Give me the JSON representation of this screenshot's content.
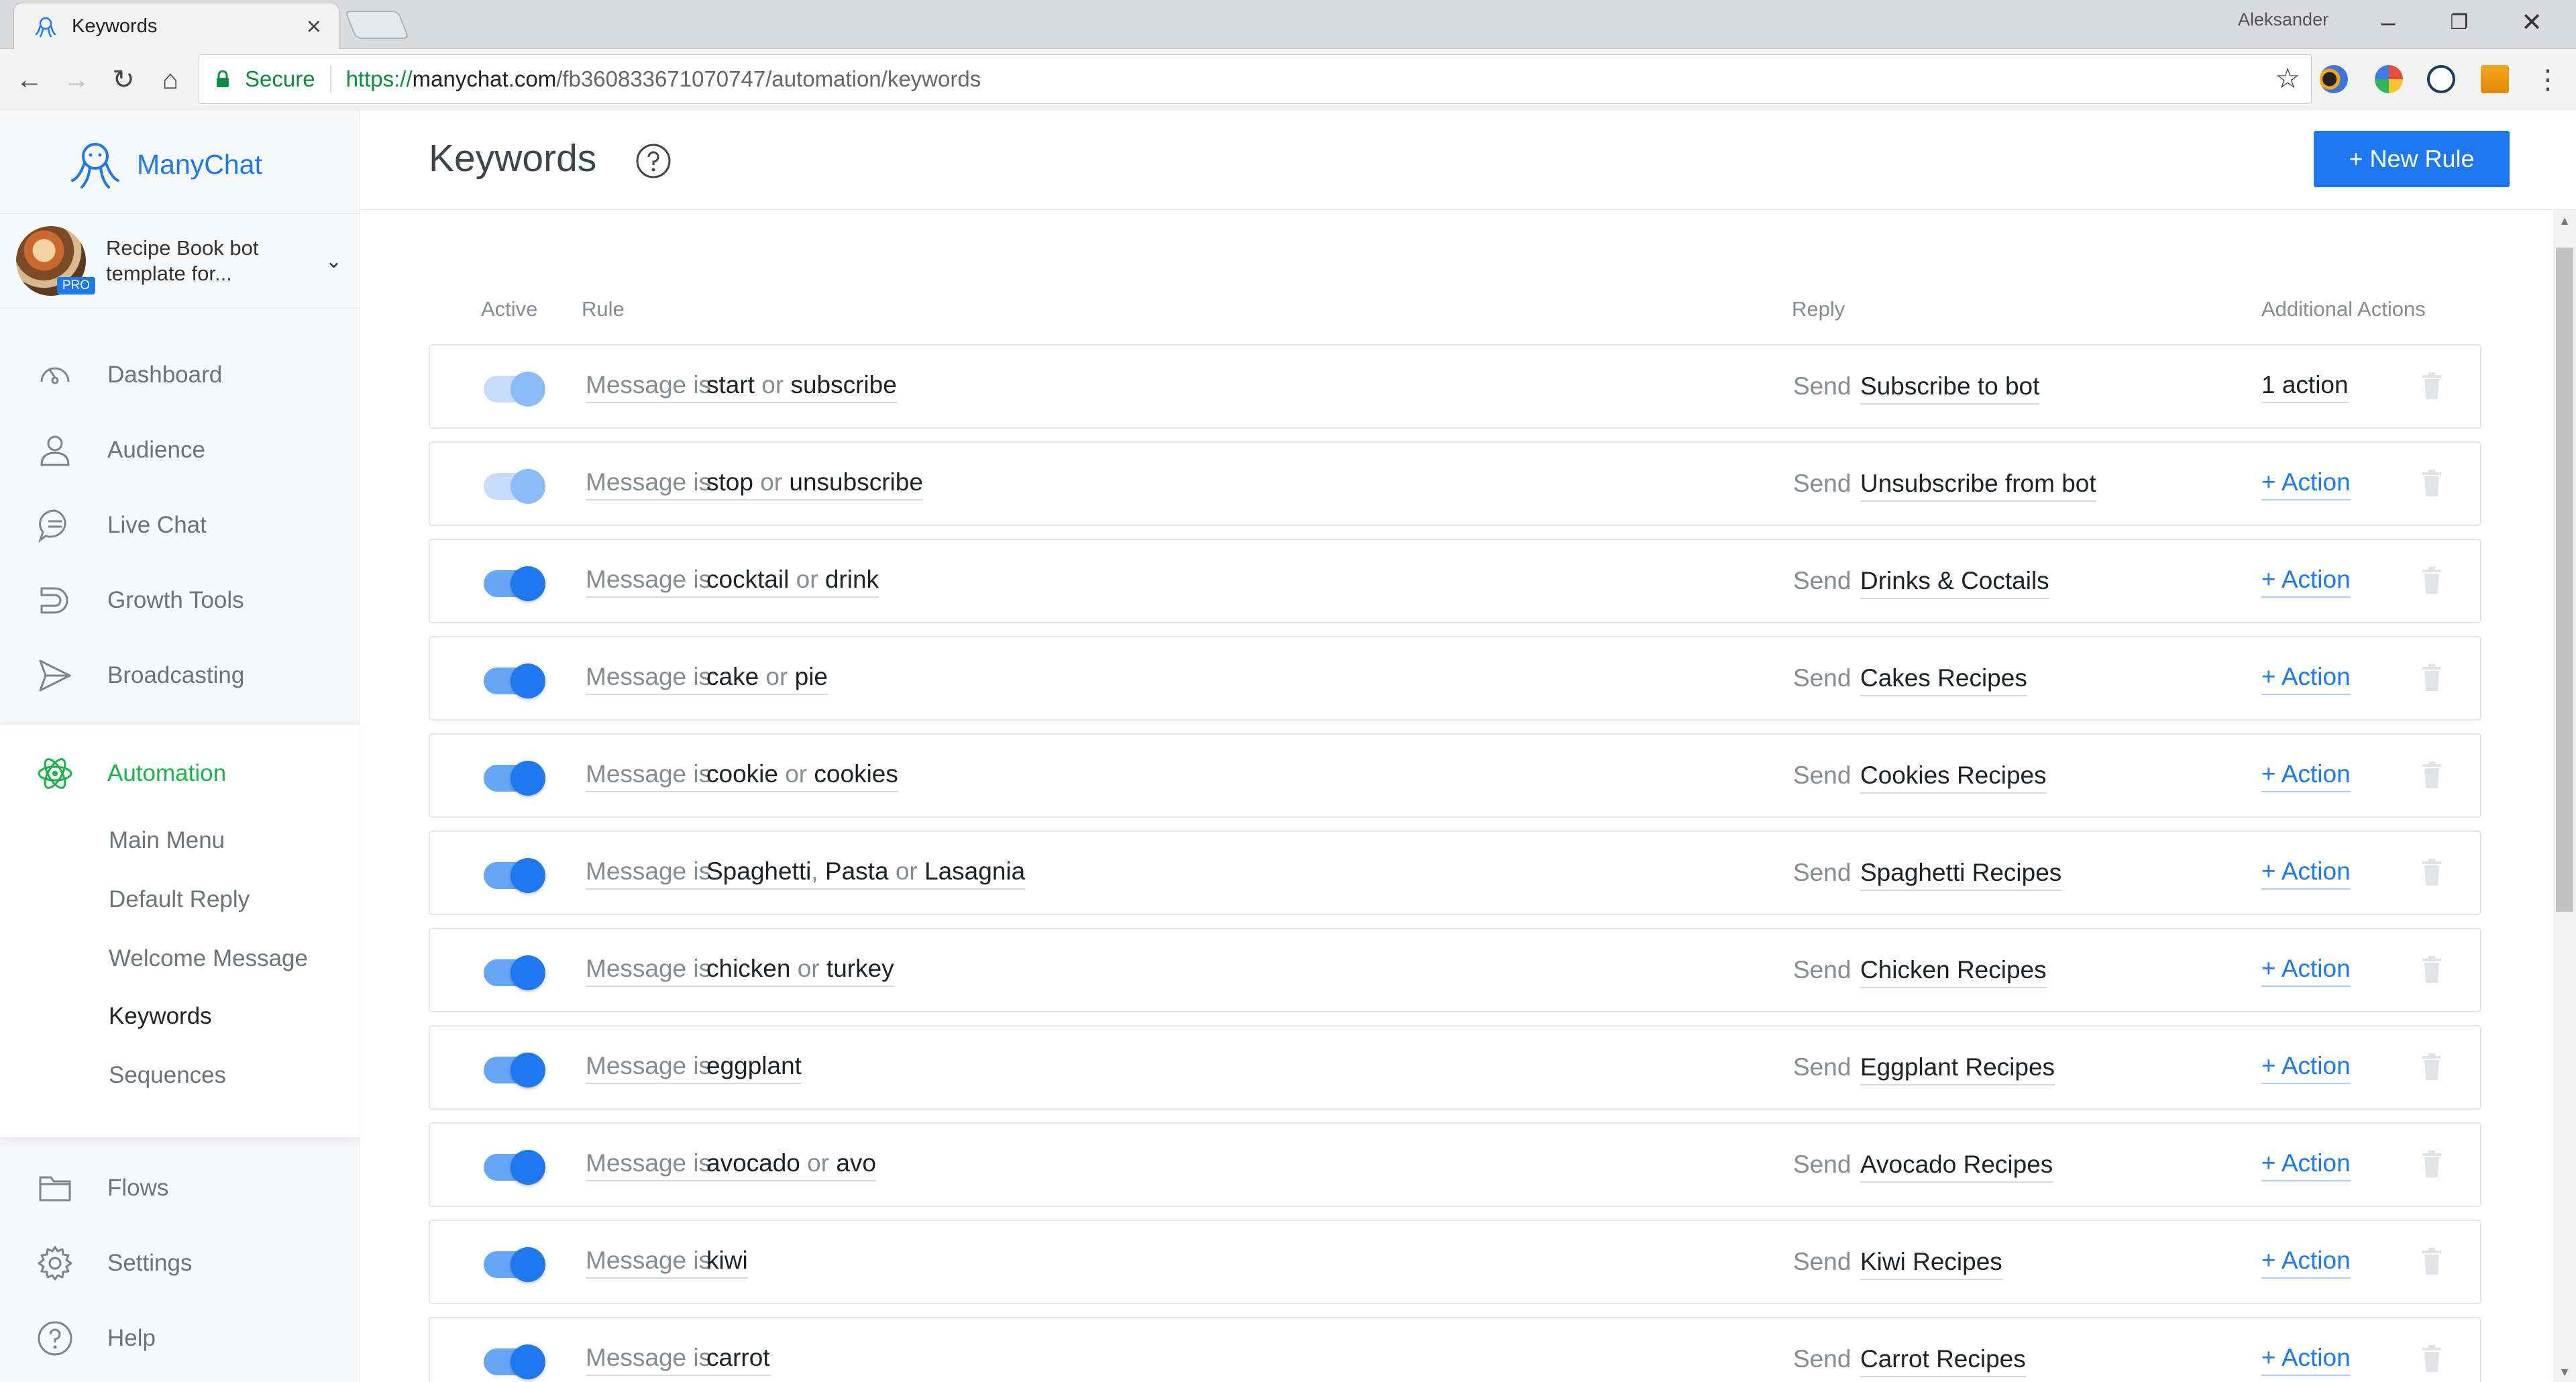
{
  "browser": {
    "tab_title": "Keywords",
    "profile_name": "Aleksander",
    "secure_label": "Secure",
    "url_protocol": "https://",
    "url_host": "manychat.com",
    "url_path": "/fb360833671070747/automation/keywords"
  },
  "sidebar": {
    "brand_name": "ManyChat",
    "bot_name_line1": "Recipe Book bot",
    "bot_name_line2": "template for...",
    "pro_badge": "PRO",
    "items": [
      {
        "label": "Dashboard",
        "icon": "dashboard-icon"
      },
      {
        "label": "Audience",
        "icon": "user-icon"
      },
      {
        "label": "Live Chat",
        "icon": "chat-bubble-icon"
      },
      {
        "label": "Growth Tools",
        "icon": "magnet-icon"
      },
      {
        "label": "Broadcasting",
        "icon": "paper-plane-icon"
      }
    ],
    "automation": {
      "label": "Automation",
      "icon": "atom-icon",
      "sub_items": [
        "Main Menu",
        "Default Reply",
        "Welcome Message",
        "Keywords",
        "Sequences"
      ],
      "active_sub_item": "Keywords"
    },
    "bottom_items": [
      {
        "label": "Flows",
        "icon": "folder-icon"
      },
      {
        "label": "Settings",
        "icon": "gear-icon"
      },
      {
        "label": "Help",
        "icon": "question-icon"
      }
    ]
  },
  "header": {
    "title": "Keywords",
    "new_rule_label": "+ New Rule"
  },
  "table": {
    "columns": {
      "active": "Active",
      "rule": "Rule",
      "reply": "Reply",
      "additional_actions": "Additional Actions"
    },
    "message_is_label": "Message is",
    "send_label": "Send",
    "rows": [
      {
        "active": true,
        "dimmed": true,
        "keywords": [
          [
            "start",
            ""
          ],
          [
            "subscribe",
            " or "
          ]
        ],
        "reply": "Subscribe to bot",
        "action": "1 action",
        "action_is_link": false
      },
      {
        "active": true,
        "dimmed": true,
        "keywords": [
          [
            "stop",
            ""
          ],
          [
            "unsubscribe",
            " or "
          ]
        ],
        "reply": "Unsubscribe from bot",
        "action": "+ Action",
        "action_is_link": true
      },
      {
        "active": true,
        "dimmed": false,
        "keywords": [
          [
            "cocktail",
            ""
          ],
          [
            "drink",
            " or "
          ]
        ],
        "reply": "Drinks & Coctails",
        "action": "+ Action",
        "action_is_link": true
      },
      {
        "active": true,
        "dimmed": false,
        "keywords": [
          [
            "cake",
            ""
          ],
          [
            "pie",
            " or "
          ]
        ],
        "reply": "Cakes Recipes",
        "action": "+ Action",
        "action_is_link": true
      },
      {
        "active": true,
        "dimmed": false,
        "keywords": [
          [
            "cookie",
            ""
          ],
          [
            "cookies",
            " or "
          ]
        ],
        "reply": "Cookies Recipes",
        "action": "+ Action",
        "action_is_link": true
      },
      {
        "active": true,
        "dimmed": false,
        "keywords": [
          [
            "Spaghetti",
            ""
          ],
          [
            "Pasta",
            ", "
          ],
          [
            "Lasagnia",
            " or "
          ]
        ],
        "reply": "Spaghetti Recipes",
        "action": "+ Action",
        "action_is_link": true
      },
      {
        "active": true,
        "dimmed": false,
        "keywords": [
          [
            "chicken",
            ""
          ],
          [
            "turkey",
            " or "
          ]
        ],
        "reply": "Chicken Recipes",
        "action": "+ Action",
        "action_is_link": true
      },
      {
        "active": true,
        "dimmed": false,
        "keywords": [
          [
            "eggplant",
            ""
          ]
        ],
        "reply": "Eggplant Recipes",
        "action": "+ Action",
        "action_is_link": true
      },
      {
        "active": true,
        "dimmed": false,
        "keywords": [
          [
            "avocado",
            ""
          ],
          [
            "avo",
            " or "
          ]
        ],
        "reply": "Avocado Recipes",
        "action": "+ Action",
        "action_is_link": true
      },
      {
        "active": true,
        "dimmed": false,
        "keywords": [
          [
            "kiwi",
            ""
          ]
        ],
        "reply": "Kiwi Recipes",
        "action": "+ Action",
        "action_is_link": true
      },
      {
        "active": true,
        "dimmed": false,
        "keywords": [
          [
            "carrot",
            ""
          ]
        ],
        "reply": "Carrot Recipes",
        "action": "+ Action",
        "action_is_link": true
      }
    ]
  },
  "colors": {
    "brand_blue": "#1e78f0",
    "automation_green": "#1bb24a",
    "secure_green": "#118b3d"
  }
}
